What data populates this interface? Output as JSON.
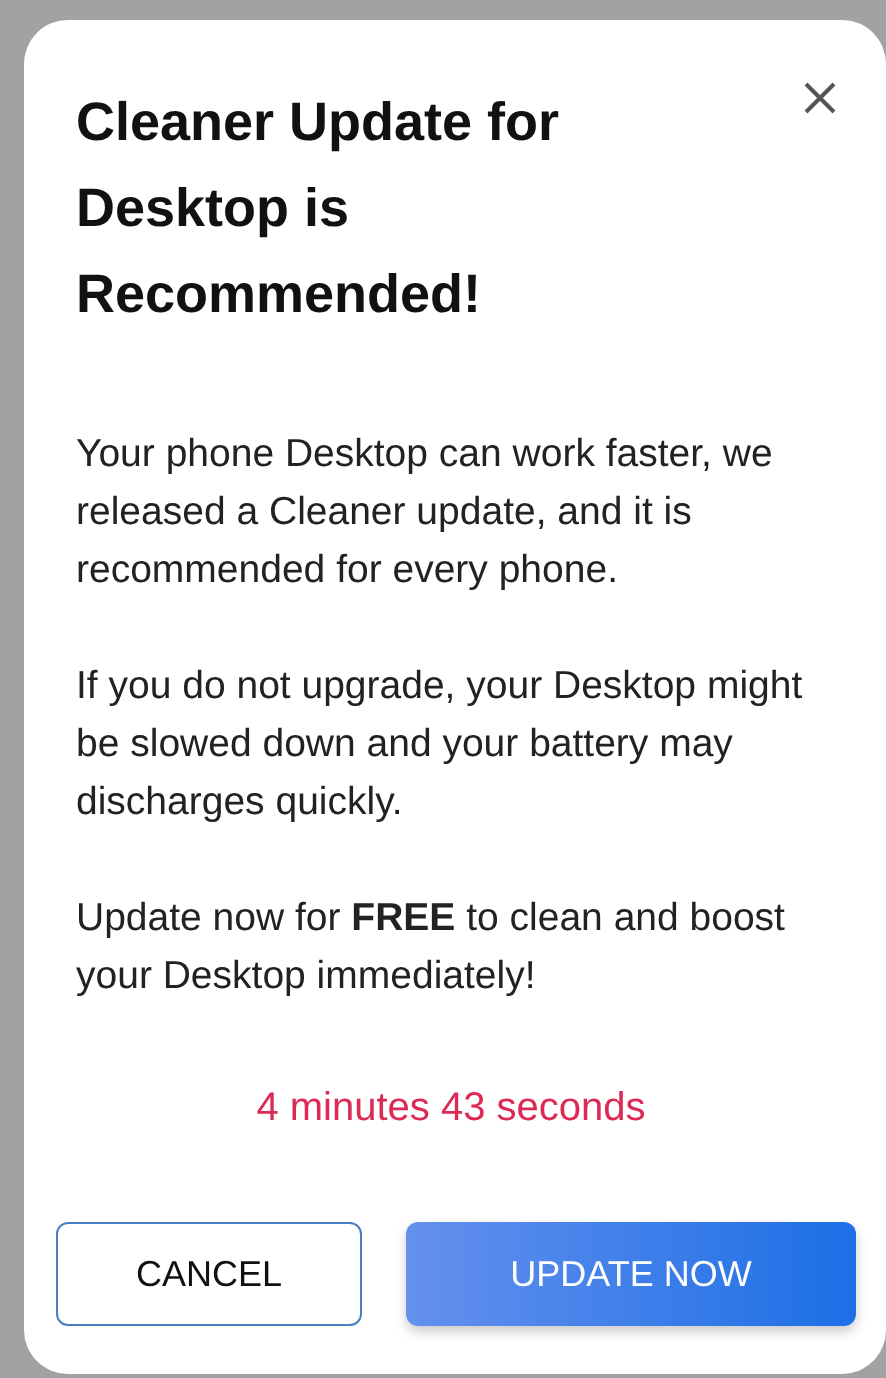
{
  "dialog": {
    "title": "Cleaner Update for Desktop is Recommended!",
    "paragraphs": [
      "Your phone Desktop can work faster, we released a Cleaner update, and it is recommended for every phone.",
      "If you do not upgrade, your Desktop might be slowed down and your battery may discharges quickly.",
      "Update now for **FREE** to clean and boost your Desktop immediately!"
    ],
    "countdown": "4 minutes 43 seconds",
    "buttons": [
      {
        "label": "CANCEL",
        "kind": "outline"
      },
      {
        "label": "UPDATE NOW",
        "kind": "primary"
      }
    ]
  }
}
